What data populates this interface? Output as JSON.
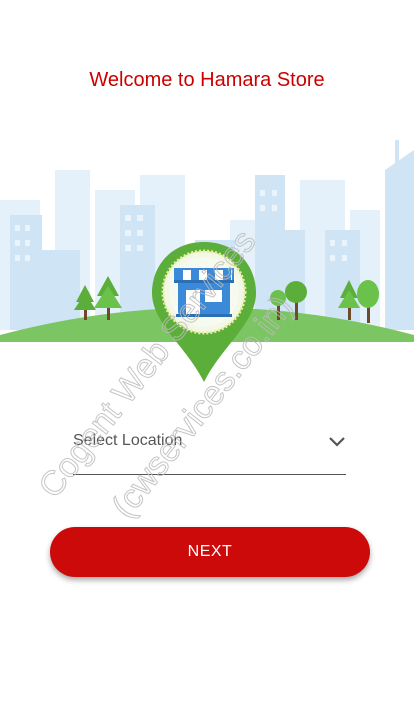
{
  "header": {
    "title": "Welcome to Hamara Store"
  },
  "form": {
    "location_placeholder": "Select Location",
    "next_label": "NEXT"
  },
  "watermark": {
    "line1": "Cogent Web Services",
    "line2": "(cwservices.co.in)"
  },
  "icons": [
    "store-icon",
    "location-pin-icon",
    "chevron-down-icon"
  ],
  "colors": {
    "accent": "#cc0000",
    "button": "#cc0a0a",
    "pin_green": "#5cae3a",
    "grass": "#7cc563",
    "sky_buildings": "#d6eaf7",
    "store_blue": "#3b8ad9"
  }
}
